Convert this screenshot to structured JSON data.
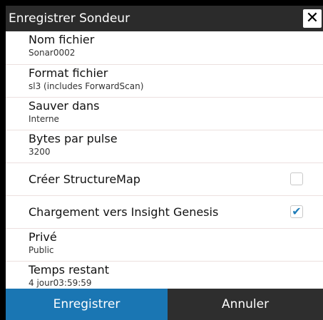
{
  "dialog": {
    "title": "Enregistrer Sondeur",
    "close_glyph": "✕"
  },
  "fields": [
    {
      "label": "Nom fichier",
      "value": "Sonar0002"
    },
    {
      "label": "Format fichier",
      "value": "sl3 (includes ForwardScan)"
    },
    {
      "label": "Sauver dans",
      "value": "Interne"
    },
    {
      "label": "Bytes par pulse",
      "value": "3200"
    }
  ],
  "options": [
    {
      "label": "Créer StructureMap",
      "checked": false,
      "check_glyph": ""
    },
    {
      "label": "Chargement vers Insight Genesis",
      "checked": true,
      "check_glyph": "✔"
    }
  ],
  "fields2": [
    {
      "label": "Privé",
      "value": "Public"
    },
    {
      "label": "Temps restant",
      "value": "4 jour03:59:59"
    }
  ],
  "buttons": {
    "save_label": "Enregistrer",
    "cancel_label": "Annuler"
  },
  "colors": {
    "accent": "#1a76b3",
    "titlebar": "#2b2b2b",
    "check": "#1f7db9"
  }
}
